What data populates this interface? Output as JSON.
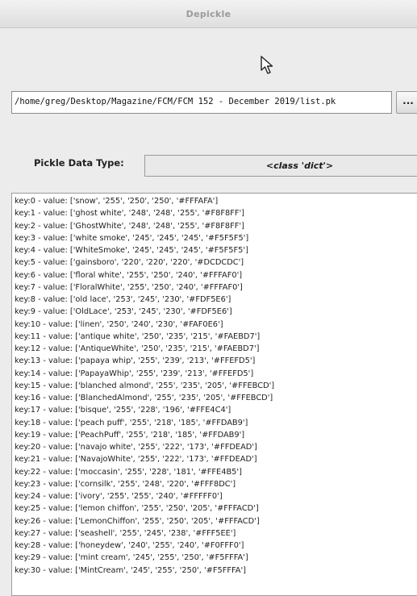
{
  "window": {
    "title": "Depickle"
  },
  "file": {
    "path": "/home/greg/Desktop/Magazine/FCM/FCM 152 - December 2019/list.pk",
    "browse_label": "..."
  },
  "data_type": {
    "label": "Pickle Data Type:",
    "value": "<class 'dict'>"
  },
  "list_items": [
    "key:0 - value: ['snow', '255', '250', '250', '#FFFAFA']",
    "key:1 - value: ['ghost white', '248', '248', '255', '#F8F8FF']",
    "key:2 - value: ['GhostWhite', '248', '248', '255', '#F8F8FF']",
    "key:3 - value: ['white smoke', '245', '245', '245', '#F5F5F5']",
    "key:4 - value: ['WhiteSmoke', '245', '245', '245', '#F5F5F5']",
    "key:5 - value: ['gainsboro', '220', '220', '220', '#DCDCDC']",
    "key:6 - value: ['floral white', '255', '250', '240', '#FFFAF0']",
    "key:7 - value: ['FloralWhite', '255', '250', '240', '#FFFAF0']",
    "key:8 - value: ['old lace', '253', '245', '230', '#FDF5E6']",
    "key:9 - value: ['OldLace', '253', '245', '230', '#FDF5E6']",
    "key:10 - value: ['linen', '250', '240', '230', '#FAF0E6']",
    "key:11 - value: ['antique white', '250', '235', '215', '#FAEBD7']",
    "key:12 - value: ['AntiqueWhite', '250', '235', '215', '#FAEBD7']",
    "key:13 - value: ['papaya whip', '255', '239', '213', '#FFEFD5']",
    "key:14 - value: ['PapayaWhip', '255', '239', '213', '#FFEFD5']",
    "key:15 - value: ['blanched almond', '255', '235', '205', '#FFEBCD']",
    "key:16 - value: ['BlanchedAlmond', '255', '235', '205', '#FFEBCD']",
    "key:17 - value: ['bisque', '255', '228', '196', '#FFE4C4']",
    "key:18 - value: ['peach puff', '255', '218', '185', '#FFDAB9']",
    "key:19 - value: ['PeachPuff', '255', '218', '185', '#FFDAB9']",
    "key:20 - value: ['navajo white', '255', '222', '173', '#FFDEAD']",
    "key:21 - value: ['NavajoWhite', '255', '222', '173', '#FFDEAD']",
    "key:22 - value: ['moccasin', '255', '228', '181', '#FFE4B5']",
    "key:23 - value: ['cornsilk', '255', '248', '220', '#FFF8DC']",
    "key:24 - value: ['ivory', '255', '255', '240', '#FFFFF0']",
    "key:25 - value: ['lemon chiffon', '255', '250', '205', '#FFFACD']",
    "key:26 - value: ['LemonChiffon', '255', '250', '205', '#FFFACD']",
    "key:27 - value: ['seashell', '255', '245', '238', '#FFF5EE']",
    "key:28 - value: ['honeydew', '240', '255', '240', '#F0FFF0']",
    "key:29 - value: ['mint cream', '245', '255', '250', '#F5FFFA']",
    "key:30 - value: ['MintCream', '245', '255', '250', '#F5FFFA']"
  ]
}
